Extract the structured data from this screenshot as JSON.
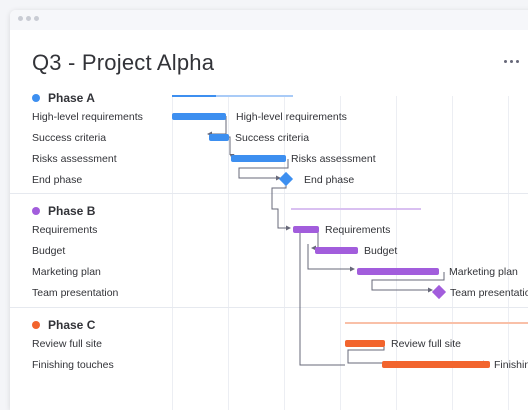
{
  "page_title": "Q3 - Project Alpha",
  "colors": {
    "phase_a": "#3d8ff0",
    "phase_b": "#a25ddc",
    "phase_c": "#f2642d",
    "connector": "#676879"
  },
  "groups": [
    {
      "name": "Phase A",
      "color": "#3d8ff0",
      "tasks": [
        {
          "label": "High-level requirements",
          "bar_label": "High-level requirements"
        },
        {
          "label": "Success criteria",
          "bar_label": "Success criteria"
        },
        {
          "label": "Risks assessment",
          "bar_label": "Risks assessment"
        },
        {
          "label": "End phase",
          "bar_label": "End phase"
        }
      ]
    },
    {
      "name": "Phase B",
      "color": "#a25ddc",
      "tasks": [
        {
          "label": "Requirements",
          "bar_label": "Requirements"
        },
        {
          "label": "Budget",
          "bar_label": "Budget"
        },
        {
          "label": "Marketing plan",
          "bar_label": "Marketing plan"
        },
        {
          "label": "Team presentation",
          "bar_label": "Team presentation"
        }
      ]
    },
    {
      "name": "Phase C",
      "color": "#f2642d",
      "tasks": [
        {
          "label": "Review full site",
          "bar_label": "Review full site"
        },
        {
          "label": "Finishing touches",
          "bar_label": "Finishing touches"
        }
      ]
    }
  ]
}
